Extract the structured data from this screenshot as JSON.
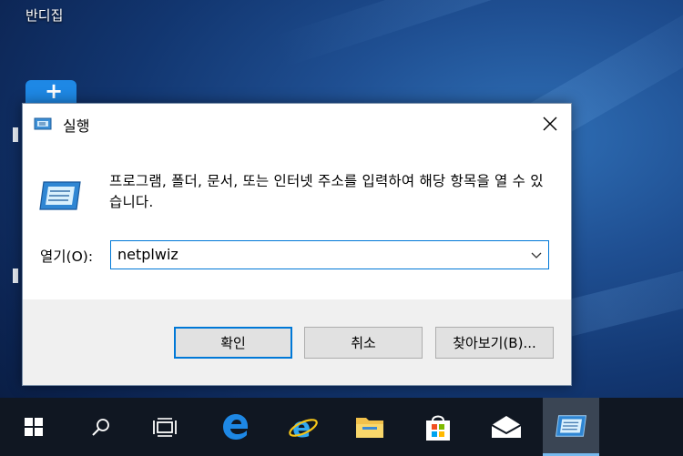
{
  "desktop": {
    "icon_label": "반디집"
  },
  "dialog": {
    "title": "실행",
    "description": "프로그램, 폴더, 문서, 또는 인터넷 주소를 입력하여 해당 항목을 열 수 있습니다.",
    "open_label": "열기(O):",
    "input_value": "netplwiz",
    "buttons": {
      "ok": "확인",
      "cancel": "취소",
      "browse": "찾아보기(B)..."
    }
  },
  "taskbar": {
    "items": [
      "start-icon",
      "search-icon",
      "task-view-icon",
      "edge-icon",
      "internet-explorer-icon",
      "file-explorer-icon",
      "store-icon",
      "mail-icon",
      "run-icon"
    ]
  },
  "colors": {
    "accent": "#0078d7",
    "taskbar": "#101722",
    "dialog_bg": "#f0f0f0"
  }
}
